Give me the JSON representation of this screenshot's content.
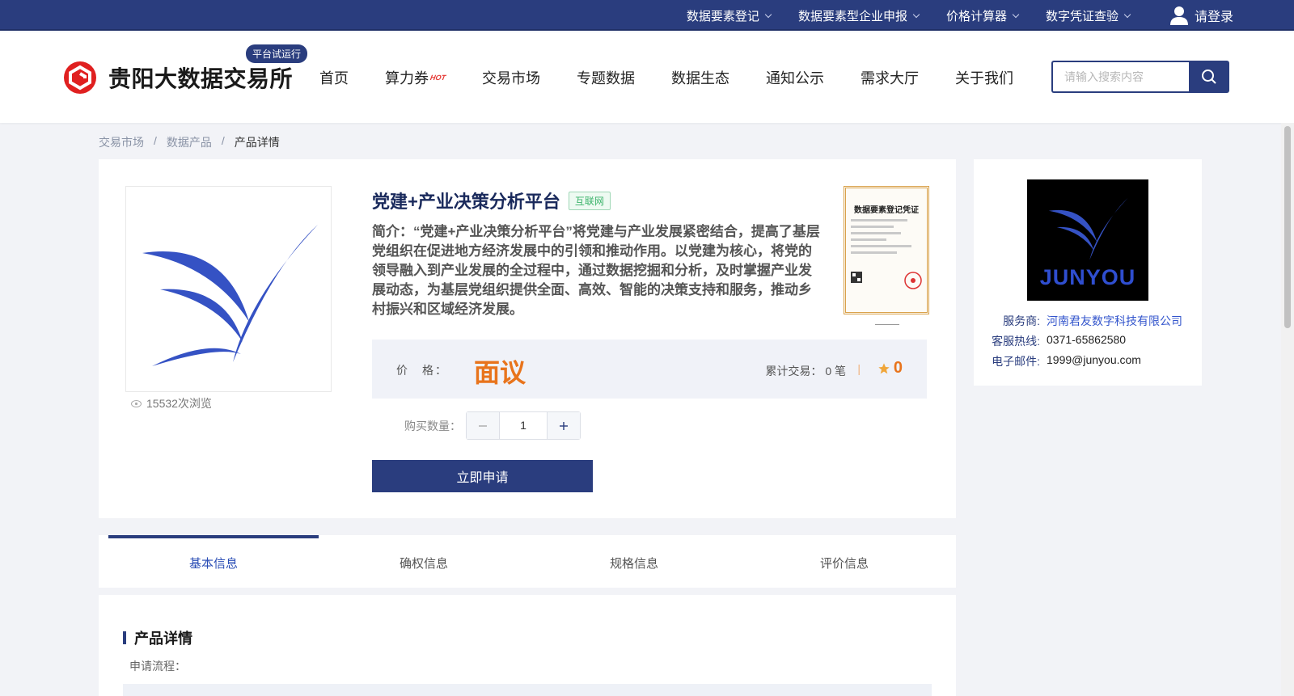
{
  "topbar": {
    "links": [
      "数据要素登记",
      "数据要素型企业申报",
      "价格计算器",
      "数字凭证查验"
    ],
    "login": "请登录"
  },
  "header": {
    "site_title": "贵阳大数据交易所",
    "trial_badge": "平台试运行",
    "nav": [
      "首页",
      "算力券",
      "交易市场",
      "专题数据",
      "数据生态",
      "通知公示",
      "需求大厅",
      "关于我们"
    ],
    "hot_label": "HOT",
    "search_placeholder": "请输入搜索内容"
  },
  "breadcrumb": [
    "交易市场",
    "数据产品",
    "产品详情"
  ],
  "breadcrumb_sep": "/",
  "product": {
    "title": "党建+产业决策分析平台",
    "tag": "互联网",
    "intro": "简介：“党建+产业决策分析平台”将党建与产业发展紧密结合，提高了基层党组织在促进地方经济发展中的引领和推动作用。以党建为核心，将党的领导融入到产业发展的全过程中，通过数据挖掘和分析，及时掌握产业发展动态，为基层党组织提供全面、高效、智能的决策支持和服务，推动乡村振兴和区域经济发展。",
    "views": "15532次浏览",
    "certificate_title": "数据要素登记凭证",
    "price_label": "价　格：",
    "price_value": "面议",
    "trades": "累计交易：",
    "trades_count": "0 笔",
    "trades_sep": "|",
    "rating": "0",
    "qty_label": "购买数量：",
    "qty_value": "1",
    "apply_button": "立即申请"
  },
  "provider": {
    "logo_text": "JUNYOU",
    "rows": [
      {
        "key": "服务商:",
        "value": "河南君友数字科技有限公司"
      },
      {
        "key": "客服热线:",
        "value": "0371-65862580"
      },
      {
        "key": "电子邮件:",
        "value": "1999@junyou.com"
      }
    ]
  },
  "tabs": [
    "基本信息",
    "确权信息",
    "规格信息",
    "评价信息"
  ],
  "details": {
    "title": "产品详情",
    "sub": "申请流程："
  },
  "colors": {
    "primary": "#2a3d7e",
    "accent_orange": "#e8741c",
    "logo_red": "#e02020",
    "tag_green": "#3bb36a"
  }
}
